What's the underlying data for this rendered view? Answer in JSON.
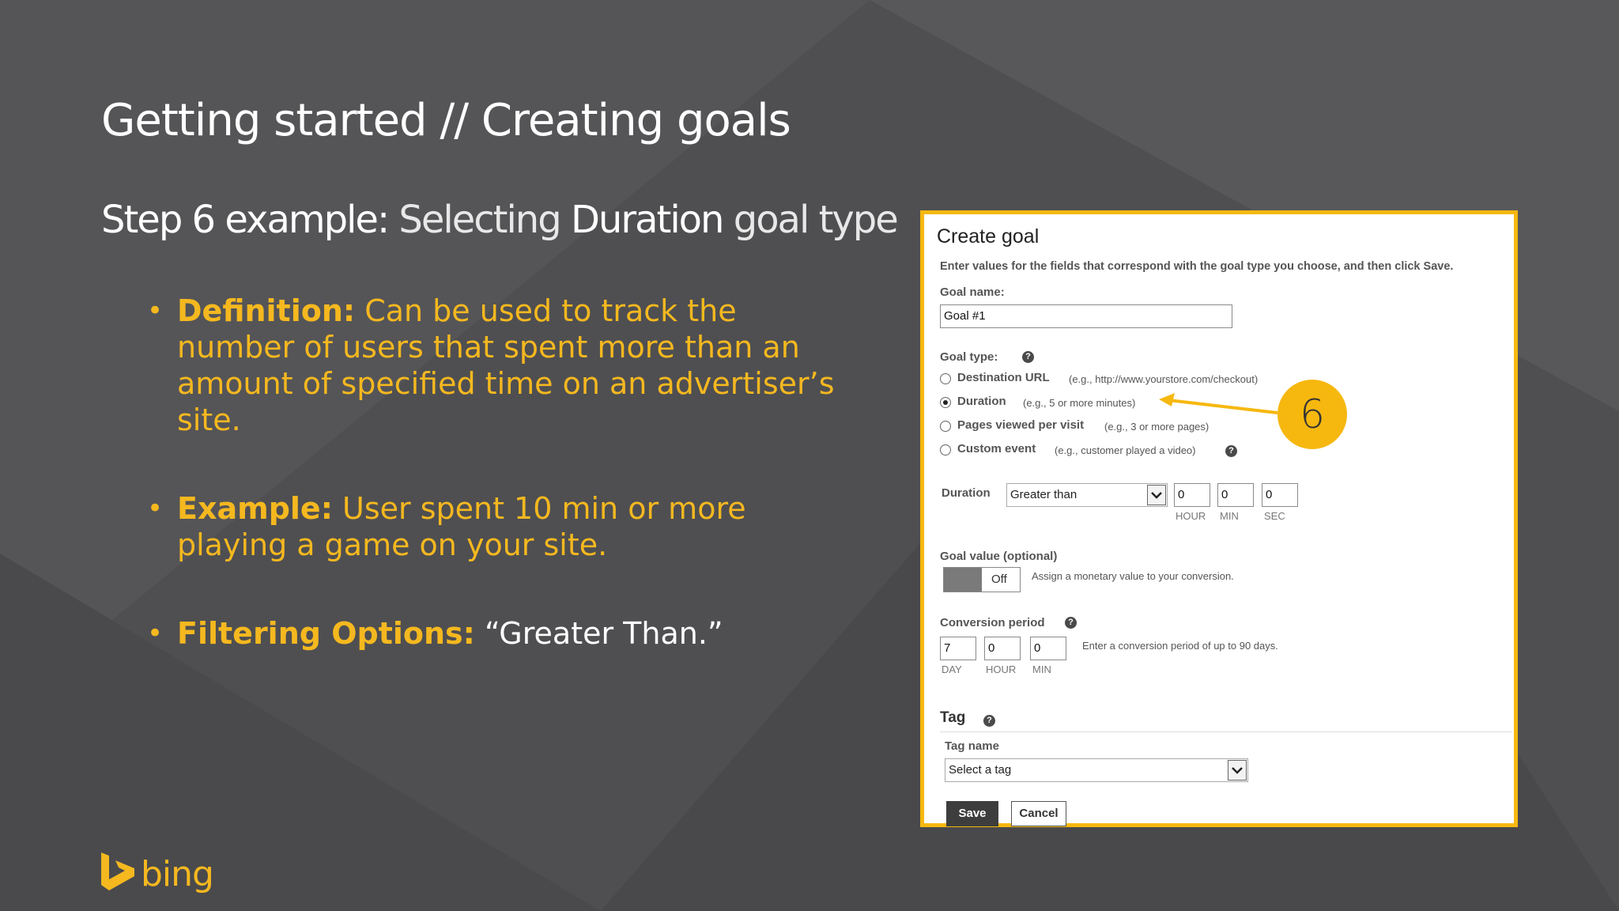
{
  "slide": {
    "title": "Getting started // Creating goals",
    "subtitle": {
      "step": "Step 6 example:",
      "selecting": "Selecting",
      "duration": "Duration",
      "rest": "goal type"
    },
    "bullets": [
      {
        "label": "Definition:",
        "text": "Can be used to track the number of users that spent more than an amount of specified time on an advertiser’s site."
      },
      {
        "label": "Example:",
        "text": "User spent 10 min or more playing a game on your site."
      },
      {
        "label": "Filtering Options:",
        "text": "“Greater Than.”"
      }
    ],
    "callout_number": "6",
    "logo_text": "bing"
  },
  "dialog": {
    "title": "Create goal",
    "instructions": "Enter values for the fields that correspond with the goal type you choose, and then click Save.",
    "goal_name_label": "Goal name:",
    "goal_name_value": "Goal #1",
    "goal_type_label": "Goal type:",
    "goal_types": [
      {
        "label": "Destination URL",
        "hint": "(e.g., http://www.yourstore.com/checkout)",
        "selected": false
      },
      {
        "label": "Duration",
        "hint": "(e.g., 5 or more minutes)",
        "selected": true
      },
      {
        "label": "Pages viewed per visit",
        "hint": "(e.g., 3 or more pages)",
        "selected": false
      },
      {
        "label": "Custom event",
        "hint": "(e.g., customer played a video)",
        "selected": false
      }
    ],
    "duration": {
      "label": "Duration",
      "operator": "Greater than",
      "hour": "0",
      "min": "0",
      "sec": "0",
      "hour_label": "HOUR",
      "min_label": "MIN",
      "sec_label": "SEC"
    },
    "goal_value": {
      "label": "Goal value (optional)",
      "toggle": "Off",
      "hint": "Assign a monetary value to your conversion."
    },
    "conversion_period": {
      "label": "Conversion period",
      "day": "7",
      "hour": "0",
      "min": "0",
      "day_label": "DAY",
      "hour_label": "HOUR",
      "min_label": "MIN",
      "hint": "Enter a conversion period of up to 90 days."
    },
    "tag": {
      "heading": "Tag",
      "name_label": "Tag name",
      "select_value": "Select a tag"
    },
    "buttons": {
      "save": "Save",
      "cancel": "Cancel"
    }
  },
  "colors": {
    "background": "#4f4f51",
    "accent": "#f5b81f",
    "frame": "#f6b80f"
  }
}
